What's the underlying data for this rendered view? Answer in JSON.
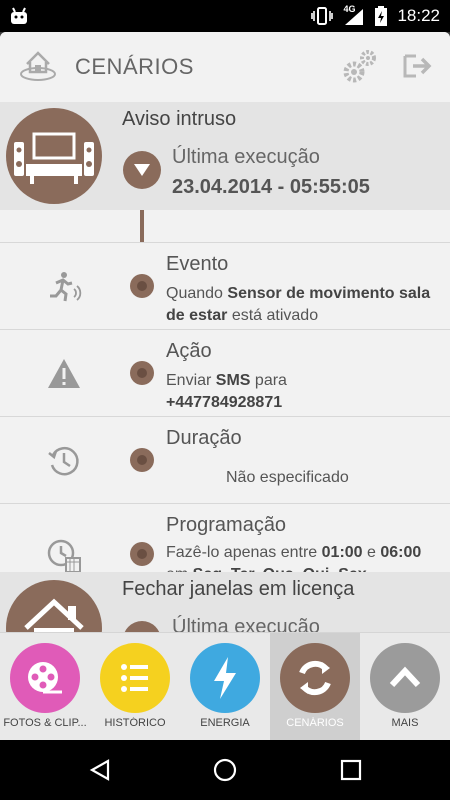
{
  "status": {
    "network": "4G",
    "time": "18:22"
  },
  "header": {
    "title": "CENÁRIOS"
  },
  "scenarios": [
    {
      "title": "Aviso intruso",
      "last_run_label": "Última execução",
      "last_run_value": "23.04.2014 - 05:55:05",
      "rows": [
        {
          "label": "Evento",
          "desc_pre": "Quando ",
          "desc_bold": "Sensor de movimento sala de estar",
          "desc_post": " está ativado"
        },
        {
          "label": "Ação",
          "desc_pre": "Enviar ",
          "desc_bold": "SMS",
          "desc_mid": " para",
          "desc_bold2": "+447784928871"
        },
        {
          "label": "Duração",
          "desc_center": "Não especificado"
        },
        {
          "label": "Programação",
          "desc_pre": "Fazê-lo apenas entre ",
          "desc_bold": "01:00",
          "desc_mid": " e ",
          "desc_bold2": "06:00",
          "desc_mid2": " em ",
          "desc_bold3": "Seg, Ter, Qua, Qui, Sex",
          "desc_post": "."
        }
      ]
    },
    {
      "title": "Fechar janelas em licença",
      "last_run_label": "Última execução"
    }
  ],
  "nav": [
    {
      "label": "FOTOS & CLIP...",
      "color": "#e05bb8"
    },
    {
      "label": "HISTÓRICO",
      "color": "#f5d11f"
    },
    {
      "label": "ENERGIA",
      "color": "#3fa9e0"
    },
    {
      "label": "CENÁRIOS",
      "color": "#8a6b5b"
    },
    {
      "label": "MAIS",
      "color": "#9b9b9b"
    }
  ],
  "colors": {
    "accent": "#8a6b5b",
    "background": "#f2f2f2"
  }
}
